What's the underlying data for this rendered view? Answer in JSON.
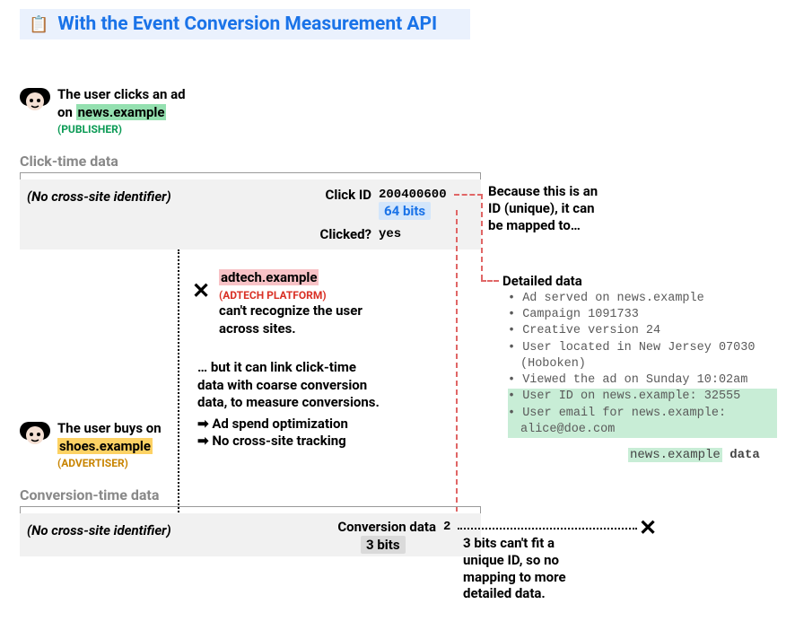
{
  "title": {
    "icon": "📋",
    "text": "With the Event Conversion Measurement API"
  },
  "step1": {
    "line1": "The user clicks an ad",
    "line2_prefix": "on ",
    "site": "news.example",
    "role": "(PUBLISHER)"
  },
  "click_section_header": "Click-time data",
  "no_id_text": "(No cross-site identifier)",
  "click_row": {
    "label_id": "Click ID",
    "value_id": "200400600",
    "bits": "64 bits",
    "label_clicked": "Clicked?",
    "value_clicked": "yes"
  },
  "because_note": {
    "l1": "Because this is an",
    "l2": "ID (unique), it can",
    "l3": "be mapped to…"
  },
  "adtech": {
    "site": "adtech.example",
    "role": "(ADTECH PLATFORM)",
    "l1": "can't recognize the user",
    "l2": "across sites."
  },
  "but_note": {
    "l1": "… but it can link click-time",
    "l2": "data with coarse conversion",
    "l3": "data, to measure conversions.",
    "a1": "Ad spend optimization",
    "a2": "No cross-site tracking"
  },
  "step2": {
    "line1": "The user buys on",
    "site": "shoes.example",
    "role": "(ADVERTISER)"
  },
  "conv_section_header": "Conversion-time data",
  "conv_row": {
    "label": "Conversion data",
    "value": "2",
    "bits": "3 bits"
  },
  "bits_note": {
    "l1": "3 bits can't fit a",
    "l2": "unique ID, so no",
    "l3": "mapping to more",
    "l4": "detailed data."
  },
  "detailed": {
    "title": "Detailed data",
    "items": [
      "Ad served on news.example",
      "Campaign 1091733",
      "Creative version 24",
      "User located in New Jersey 07030 (Hoboken)",
      "Viewed the ad on Sunday 10:02am"
    ],
    "hl_items": [
      "User ID on news.example: 32555",
      "User email for news.example: alice@doe.com"
    ],
    "footer_site": "news.example",
    "footer_suffix": " data"
  }
}
